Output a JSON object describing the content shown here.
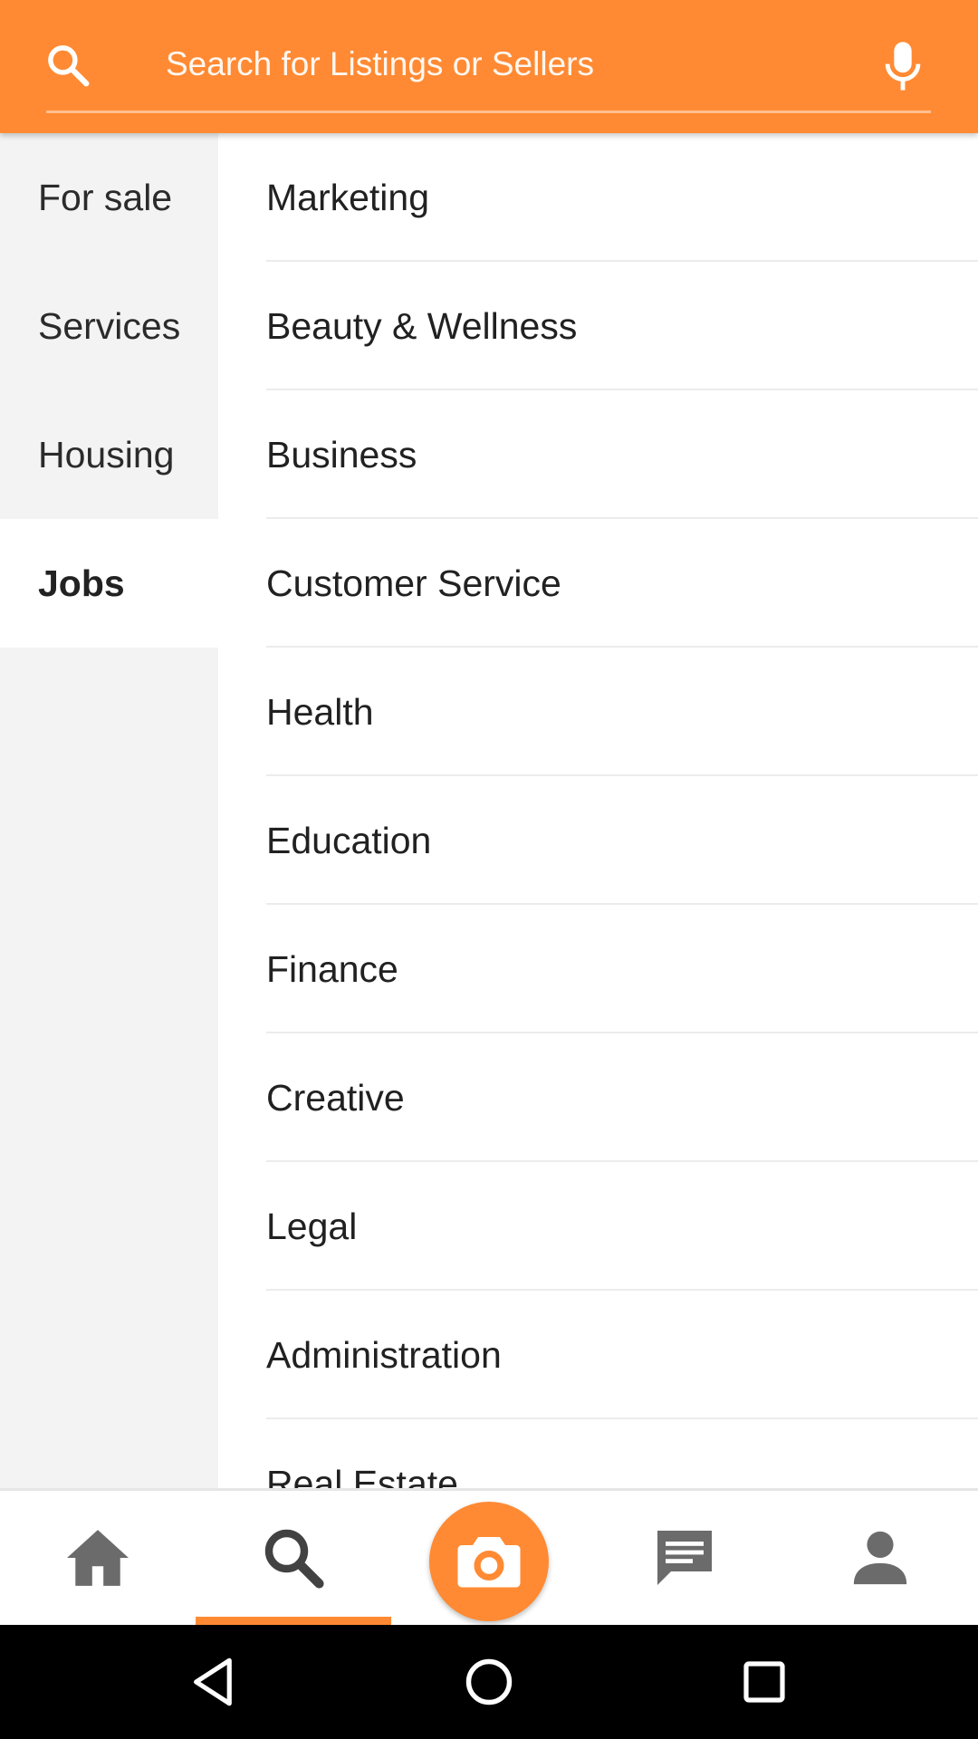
{
  "search": {
    "placeholder": "Search for Listings or Sellers",
    "icon": "search-icon",
    "voice_icon": "mic-icon"
  },
  "categories": [
    {
      "label": "For sale",
      "active": false
    },
    {
      "label": "Services",
      "active": false
    },
    {
      "label": "Housing",
      "active": false
    },
    {
      "label": "Jobs",
      "active": true
    }
  ],
  "subcategories": [
    "Marketing",
    "Beauty & Wellness",
    "Business",
    "Customer Service",
    "Health",
    "Education",
    "Finance",
    "Creative",
    "Legal",
    "Administration",
    "Real Estate"
  ],
  "bottom_nav": {
    "items": [
      "home-icon",
      "search-icon",
      "camera-icon",
      "chat-icon",
      "profile-icon"
    ],
    "selected": "search-icon"
  },
  "system_nav": [
    "back-icon",
    "home-circle-icon",
    "recents-icon"
  ],
  "colors": {
    "accent": "#ff8a33",
    "sidebar_bg": "#f3f3f3",
    "text": "#212121"
  }
}
